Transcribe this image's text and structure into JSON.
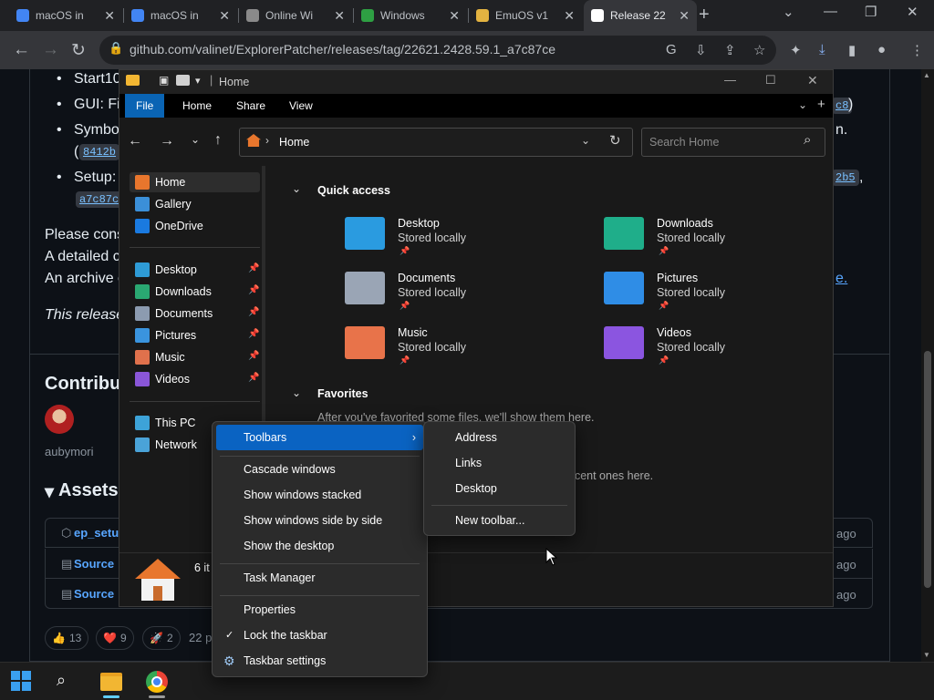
{
  "browser": {
    "tabs": [
      {
        "title": "macOS in",
        "fav_color": "#4285f4"
      },
      {
        "title": "macOS in",
        "fav_color": "#4285f4"
      },
      {
        "title": "Online Wi",
        "fav_color": "#8a8a8a"
      },
      {
        "title": "Windows",
        "fav_color": "#2ea043"
      },
      {
        "title": "EmuOS v1",
        "fav_color": "#e3b341"
      },
      {
        "title": "Release 22",
        "fav_color": "#ffffff"
      }
    ],
    "new_tab": "+",
    "url": "github.com/valinet/ExplorerPatcher/releases/tag/22621.2428.59.1_a7c87ce"
  },
  "github": {
    "bullets": [
      "Start10",
      "GUI: Fi",
      "Symbo",
      "Setup:"
    ],
    "chips": [
      "8412b",
      "a7c87c",
      "c8",
      "2b5"
    ],
    "paren_open": "(",
    "paren_close": ")",
    "suffix_n": "n.",
    "comma": ",",
    "dot_e": "e.",
    "lines": [
      "Please cons",
      "A detailed c",
      "An archive c"
    ],
    "italic_line": "This release",
    "contributors_heading": "Contribut",
    "contributor_name": "aubymori",
    "assets_heading": "Assets",
    "asset_rows": [
      {
        "name": "ep_setu",
        "time": "ago"
      },
      {
        "name": "Source",
        "time": "ago"
      },
      {
        "name": "Source",
        "time": "ago"
      }
    ],
    "reactions": [
      {
        "emoji": "👍",
        "count": "13"
      },
      {
        "emoji": "❤️",
        "count": "9"
      },
      {
        "emoji": "🚀",
        "count": "2"
      }
    ],
    "people_count": "22 p"
  },
  "explorer": {
    "title": "Home",
    "ribbon_tabs": [
      "File",
      "Home",
      "Share",
      "View"
    ],
    "address": "Home",
    "search_placeholder": "Search Home",
    "sidebar": {
      "top": [
        {
          "label": "Home",
          "color": "#e8762d",
          "icon": "home-icon"
        },
        {
          "label": "Gallery",
          "color": "#3b8fd8",
          "icon": "gallery-icon"
        },
        {
          "label": "OneDrive",
          "color": "#1a7ae0",
          "icon": "onedrive-icon"
        }
      ],
      "pinned": [
        {
          "label": "Desktop",
          "color": "#2e9bd6",
          "icon": "desktop-icon"
        },
        {
          "label": "Downloads",
          "color": "#2aa872",
          "icon": "downloads-icon"
        },
        {
          "label": "Documents",
          "color": "#8c9bb0",
          "icon": "documents-icon"
        },
        {
          "label": "Pictures",
          "color": "#3a94de",
          "icon": "pictures-icon"
        },
        {
          "label": "Music",
          "color": "#e0714c",
          "icon": "music-icon"
        },
        {
          "label": "Videos",
          "color": "#8a56d8",
          "icon": "videos-icon"
        }
      ],
      "bottom": [
        {
          "label": "This PC",
          "color": "#3da3d8",
          "icon": "pc-icon"
        },
        {
          "label": "Network",
          "color": "#4aa3d8",
          "icon": "network-icon"
        }
      ]
    },
    "quick_access_title": "Quick access",
    "quick_access": [
      {
        "name": "Desktop",
        "status": "Stored locally",
        "color": "#2a9be0"
      },
      {
        "name": "Downloads",
        "status": "Stored locally",
        "color": "#1fae8a"
      },
      {
        "name": "Documents",
        "status": "Stored locally",
        "color": "#9aa5b5"
      },
      {
        "name": "Pictures",
        "status": "Stored locally",
        "color": "#2f8de6"
      },
      {
        "name": "Music",
        "status": "Stored locally",
        "color": "#e8734a"
      },
      {
        "name": "Videos",
        "status": "Stored locally",
        "color": "#8b55e0"
      }
    ],
    "favorites_title": "Favorites",
    "favorites_text": "After you've favorited some files, we'll show them here.",
    "recent_fragment": "ecent ones here.",
    "status_text": "6 it"
  },
  "context_menu": {
    "toolbars": "Toolbars",
    "items_group1": [
      "Cascade windows",
      "Show windows stacked",
      "Show windows side by side",
      "Show the desktop"
    ],
    "task_manager": "Task Manager",
    "properties": "Properties",
    "lock_taskbar": "Lock the taskbar",
    "taskbar_settings": "Taskbar settings"
  },
  "submenu": {
    "items": [
      "Address",
      "Links",
      "Desktop"
    ],
    "new_toolbar": "New toolbar..."
  }
}
